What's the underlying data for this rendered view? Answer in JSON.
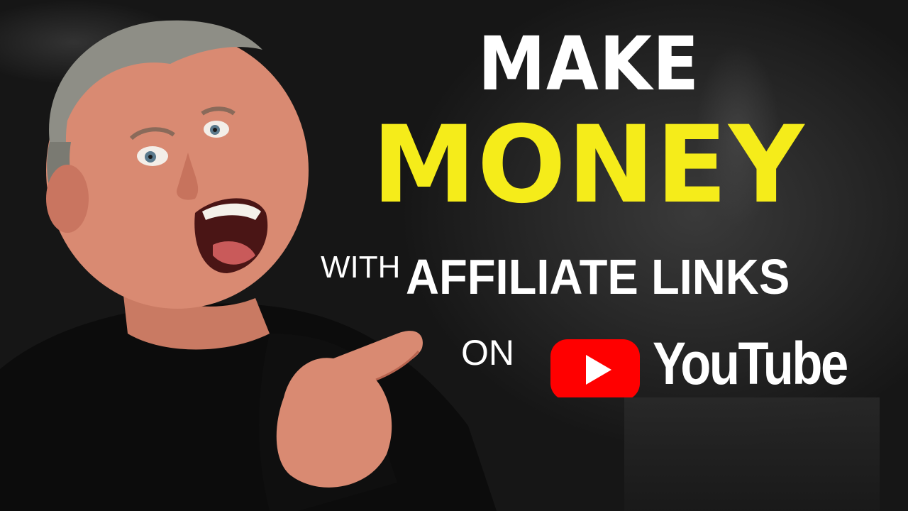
{
  "headline": {
    "line1": "MAKE",
    "line2": "MONEY",
    "line3_small": "WITH",
    "line3_large": "AFFILIATE LINKS",
    "line4": "ON",
    "brand_wordmark": "YouTube"
  },
  "colors": {
    "primary_text": "#ffffff",
    "accent_yellow": "#f5ec1a",
    "youtube_red": "#ff0000",
    "background": "#1e1e1e"
  },
  "icons": {
    "brand_logo": "youtube-play-icon"
  }
}
